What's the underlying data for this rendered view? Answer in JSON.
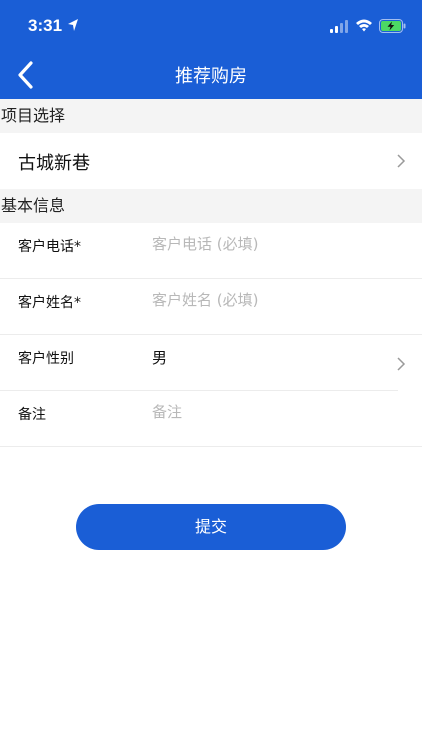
{
  "status_bar": {
    "time": "3:31",
    "icons": [
      "location-arrow-icon",
      "cellular-signal-icon",
      "wifi-icon",
      "battery-charging-icon"
    ]
  },
  "navbar": {
    "title": "推荐购房",
    "back_icon": "chevron-left-icon"
  },
  "project_section": {
    "header": "项目选择",
    "selected_project": "古城新巷",
    "chevron_icon": "chevron-right-icon"
  },
  "basic_section": {
    "header": "基本信息",
    "fields": [
      {
        "label": "客户电话*",
        "value": "",
        "placeholder": "客户电话 (必填)"
      },
      {
        "label": "客户姓名*",
        "value": "",
        "placeholder": "客户姓名 (必填)"
      },
      {
        "label": "客户性别",
        "value": "男"
      },
      {
        "label": "备注",
        "value": "",
        "placeholder": "备注"
      }
    ]
  },
  "submit_label": "提交",
  "colors": {
    "primary": "#1a5ed6",
    "section_bg": "#f4f4f4",
    "placeholder": "#b8b8b8"
  }
}
